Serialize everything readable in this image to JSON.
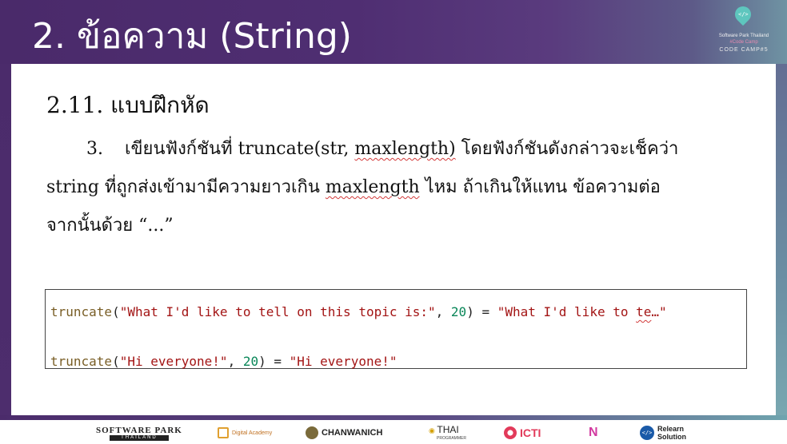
{
  "header": {
    "title": "2. ข้อความ (String)"
  },
  "logo": {
    "pin_glyph": "</>",
    "line1": "Software Park Thailand",
    "line2": "#Code Camp",
    "line3": "CODE CAMP#5"
  },
  "section": {
    "heading": "2.11.  แบบฝึกหัด"
  },
  "exercise": {
    "number": "3.",
    "line1_a": "เขียนฟังก์ชันที่ truncate(str, ",
    "line1_b": "maxlength)",
    "line1_c": " โดยฟังก์ชันดังกล่าวจะเช็คว่า",
    "line2_a": "string ที่ถูกส่งเข้ามามีความยาวเกิน ",
    "line2_b": "maxlength",
    "line2_c": " ไหม ถ้าเกินให้แทน ข้อความต่อ",
    "line3": "จากนั้นด้วย “...”"
  },
  "code": {
    "line1": {
      "fn": "truncate",
      "open": "(",
      "arg": "\"What I'd like to tell on this topic is:\"",
      "comma": ", ",
      "num": "20",
      "close": ") = ",
      "result_a": "\"What I'd like to ",
      "result_b": "te",
      "result_c": "…\""
    },
    "line2": {
      "fn": "truncate",
      "open": "(",
      "arg": "\"Hi everyone!\"",
      "comma": ", ",
      "num": "20",
      "close": ") = ",
      "result": "\"Hi everyone!\""
    }
  },
  "sponsors": [
    {
      "name": "SOFTWARE PARK",
      "sub": "THAILAND",
      "icon": "software-park-logo"
    },
    {
      "name": "Digital Academy",
      "icon": "digital-academy-logo"
    },
    {
      "name": "CHANWANICH",
      "icon": "chanwanich-logo"
    },
    {
      "name": "THAI",
      "sub": "PROGRAMMER",
      "icon": "thai-programmer-logo"
    },
    {
      "name": "ICTI",
      "icon": "icti-logo"
    },
    {
      "name": "N",
      "icon": "n-logo"
    },
    {
      "name": "Relearn",
      "sub": "Solution",
      "icon": "relearn-logo"
    }
  ],
  "colors": {
    "header_purple": "#4f2e72",
    "accent_teal": "#6fa4ae",
    "code_function": "#795e26",
    "code_string": "#a31515",
    "code_number": "#098658"
  }
}
